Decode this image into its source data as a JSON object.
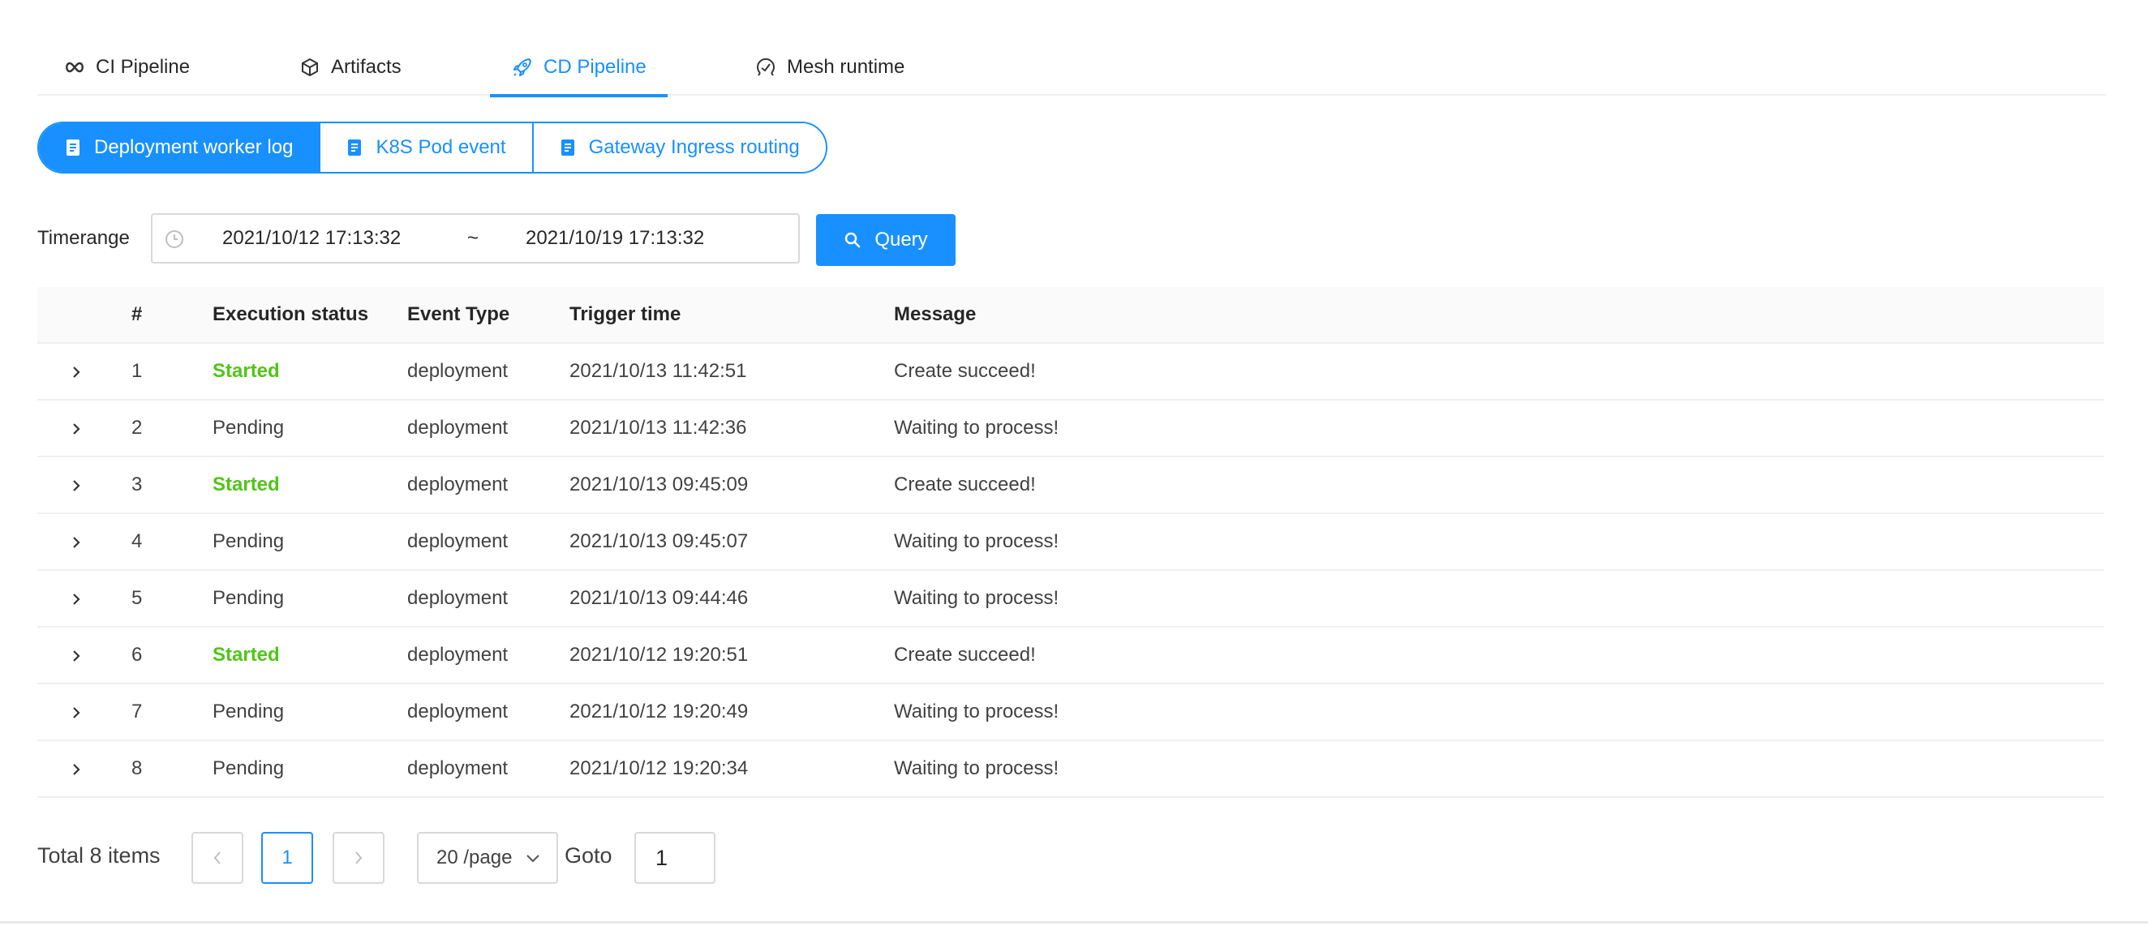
{
  "tabs": [
    {
      "label": "CI Pipeline",
      "icon": "infinity-icon",
      "active": false
    },
    {
      "label": "Artifacts",
      "icon": "cube-icon",
      "active": false
    },
    {
      "label": "CD Pipeline",
      "icon": "rocket-icon",
      "active": true
    },
    {
      "label": "Mesh runtime",
      "icon": "dashboard-icon",
      "active": false
    }
  ],
  "log_tabs": [
    {
      "label": "Deployment worker log",
      "icon": "document-icon",
      "active": true
    },
    {
      "label": "K8S Pod event",
      "icon": "document-icon",
      "active": false
    },
    {
      "label": "Gateway Ingress routing",
      "icon": "document-icon",
      "active": false
    }
  ],
  "filter": {
    "label": "Timerange",
    "start": "2021/10/12 17:13:32",
    "separator": "~",
    "end": "2021/10/19 17:13:32",
    "query_label": "Query"
  },
  "table": {
    "columns": [
      "#",
      "Execution status",
      "Event Type",
      "Trigger time",
      "Message"
    ],
    "rows": [
      {
        "num": "1",
        "status": "Started",
        "type": "deployment",
        "time": "2021/10/13 11:42:51",
        "message": "Create succeed!"
      },
      {
        "num": "2",
        "status": "Pending",
        "type": "deployment",
        "time": "2021/10/13 11:42:36",
        "message": "Waiting to process!"
      },
      {
        "num": "3",
        "status": "Started",
        "type": "deployment",
        "time": "2021/10/13 09:45:09",
        "message": "Create succeed!"
      },
      {
        "num": "4",
        "status": "Pending",
        "type": "deployment",
        "time": "2021/10/13 09:45:07",
        "message": "Waiting to process!"
      },
      {
        "num": "5",
        "status": "Pending",
        "type": "deployment",
        "time": "2021/10/13 09:44:46",
        "message": "Waiting to process!"
      },
      {
        "num": "6",
        "status": "Started",
        "type": "deployment",
        "time": "2021/10/12 19:20:51",
        "message": "Create succeed!"
      },
      {
        "num": "7",
        "status": "Pending",
        "type": "deployment",
        "time": "2021/10/12 19:20:49",
        "message": "Waiting to process!"
      },
      {
        "num": "8",
        "status": "Pending",
        "type": "deployment",
        "time": "2021/10/12 19:20:34",
        "message": "Waiting to process!"
      }
    ]
  },
  "pagination": {
    "total": "Total 8 items",
    "current_page": "1",
    "page_size": "20 /page",
    "goto_label": "Goto",
    "goto_value": "1"
  },
  "colors": {
    "accent": "#1890ff",
    "started": "#52c41a"
  }
}
